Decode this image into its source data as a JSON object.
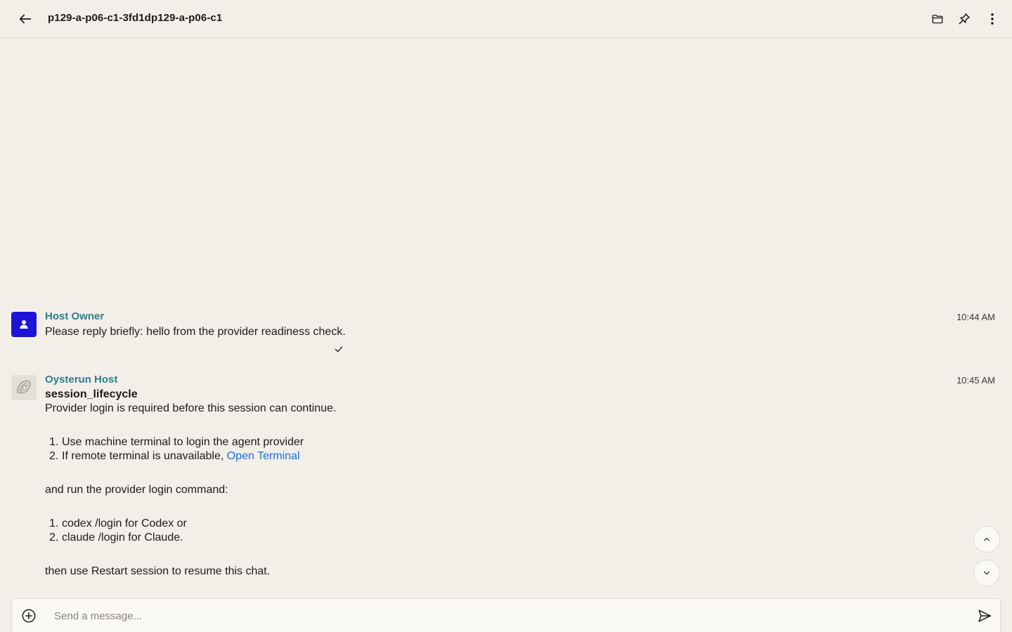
{
  "header": {
    "title": "p129-a-p06-c1-3fd1dp129-a-p06-c1",
    "icons": {
      "back": "arrow-left-icon",
      "folder": "folder-icon",
      "pin": "pin-icon",
      "more": "more-vertical-icon"
    }
  },
  "messages": [
    {
      "sender": "Host Owner",
      "time": "10:44 AM",
      "text": "Please reply briefly: hello from the provider readiness check.",
      "status_icon": "check-icon"
    },
    {
      "sender": "Oysterun Host",
      "time": "10:45 AM",
      "heading": "session_lifecycle",
      "intro": "Provider login is required before this session can continue.",
      "steps": [
        {
          "num": "1.",
          "text": "Use machine terminal to login the agent provider"
        },
        {
          "num": "2.",
          "text": "If remote terminal is unavailable, ",
          "link": "Open Terminal"
        }
      ],
      "middle": "and run the provider login command:",
      "commands": [
        {
          "num": "1.",
          "text": "codex /login for Codex or"
        },
        {
          "num": "2.",
          "text": "claude /login for Claude."
        }
      ],
      "outro": "then use Restart session to resume this chat."
    }
  ],
  "composer": {
    "placeholder": "Send a message..."
  },
  "colors": {
    "background": "#f2efe9",
    "sender": "#2f7d8c",
    "link": "#1a6fd6",
    "owner_avatar": "#1a14d8"
  }
}
